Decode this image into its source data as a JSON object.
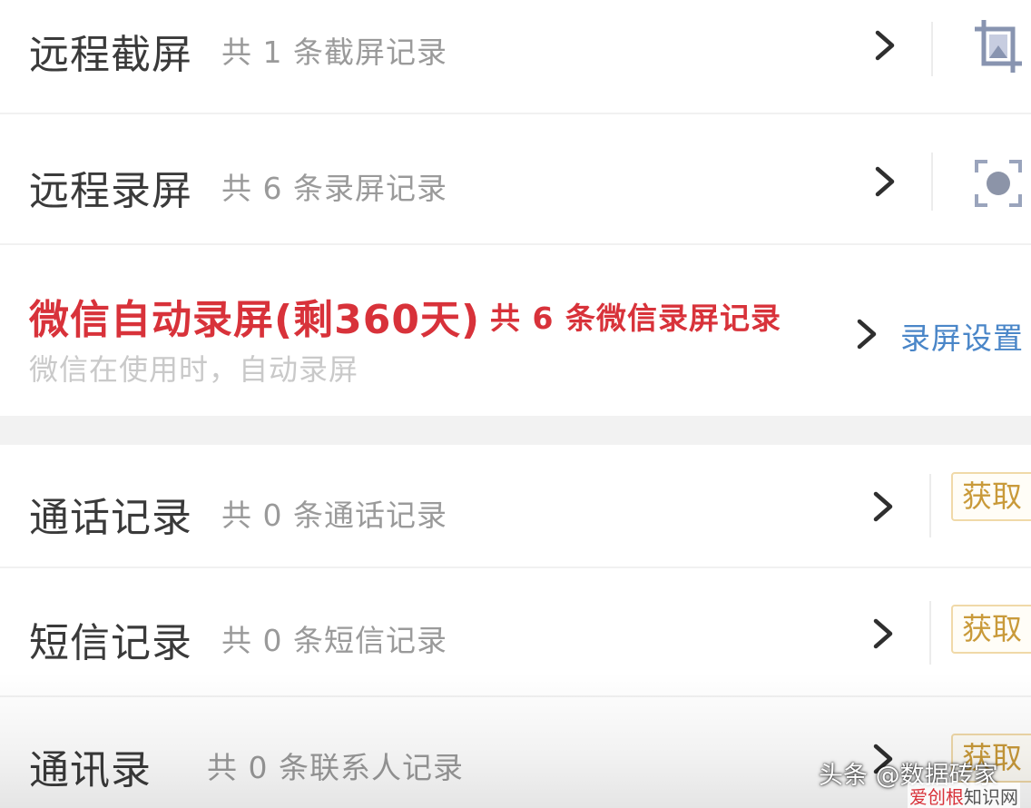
{
  "rows": {
    "screenshot": {
      "title": "远程截屏",
      "subtitle": "共 1 条截屏记录",
      "icon": "crop-icon"
    },
    "record": {
      "title": "远程录屏",
      "subtitle": "共 6 条录屏记录",
      "icon": "record-icon"
    },
    "wechat": {
      "title": "微信自动录屏(剩360天)",
      "subtitle": "共 6 条微信录屏记录",
      "description": "微信在使用时，自动录屏",
      "action": "录屏设置"
    },
    "calls": {
      "title": "通话记录",
      "subtitle": "共 0 条通话记录",
      "action": "获取"
    },
    "sms": {
      "title": "短信记录",
      "subtitle": "共 0 条短信记录",
      "action": "获取"
    },
    "contacts": {
      "title": "通讯录",
      "subtitle": "共 0 条联系人记录",
      "action": "获取"
    }
  },
  "watermark": {
    "main": "头条 @数据砖家",
    "site_a": "爱创根",
    "site_b": "知识网"
  },
  "colors": {
    "title": "#3a3a3a",
    "subtitle": "#9a9a9a",
    "accent_red": "#d8323a",
    "link_blue": "#4a86c8",
    "get_button": "#c99a3a",
    "section_gap": "#f2f2f2"
  }
}
